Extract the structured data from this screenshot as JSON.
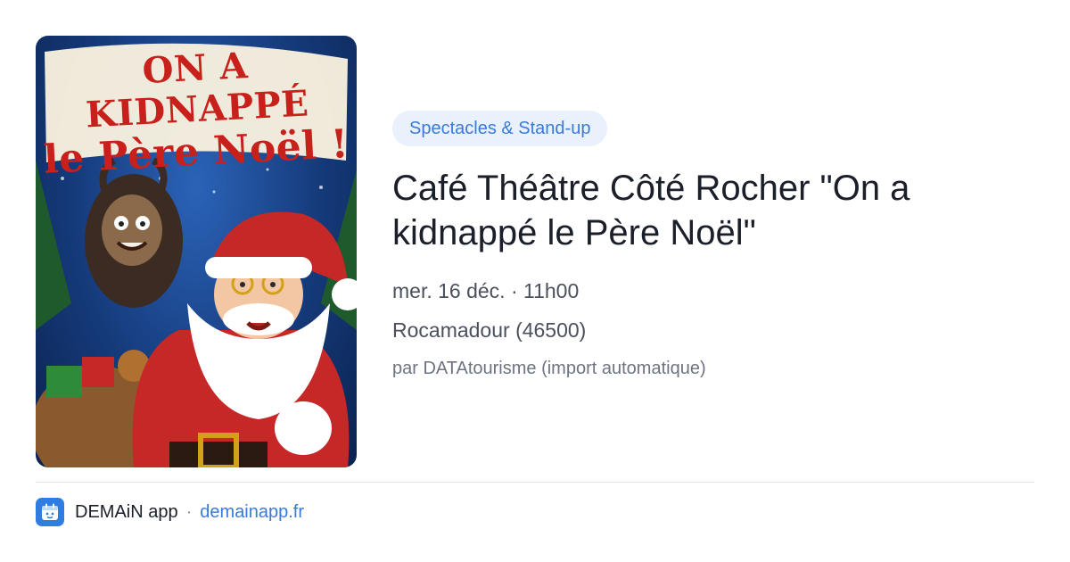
{
  "poster": {
    "title_line1": "ON A KIDNAPPÉ",
    "title_line2": "le Père Noël !"
  },
  "event": {
    "category": "Spectacles & Stand-up",
    "title": "Café Théâtre Côté Rocher \"On a kidnappé le Père Noël\"",
    "datetime": "mer. 16 déc. · 11h00",
    "location": "Rocamadour (46500)",
    "source": "par DATAtourisme (import automatique)"
  },
  "footer": {
    "app_icon": "calendar-app-icon",
    "app_name": "DEMAiN app",
    "separator": "·",
    "url": "demainapp.fr"
  },
  "colors": {
    "accent": "#3a7ad8",
    "tag_bg": "#e9f1fd",
    "title_text": "#1b1f2a",
    "meta_text": "#4a505c",
    "poster_red": "#c8211b"
  }
}
